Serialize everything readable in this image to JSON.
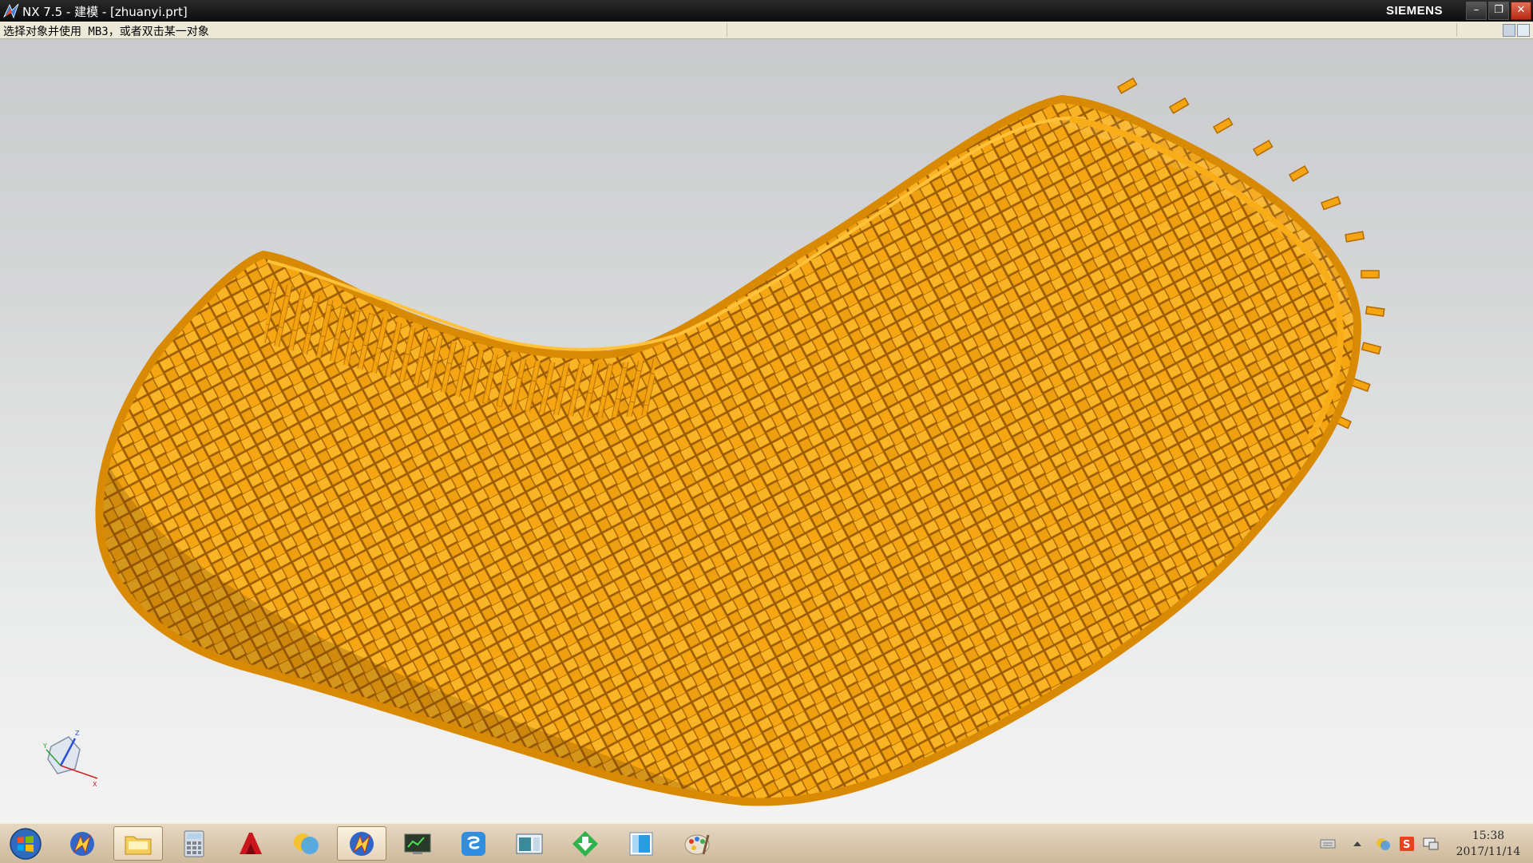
{
  "window": {
    "title": "NX 7.5 - 建模 - [zhuanyi.prt]",
    "brand": "SIEMENS",
    "minimize_icon": "minimize-icon",
    "restore_icon": "restore-icon",
    "close_icon": "close-icon"
  },
  "cue_line": {
    "prompt": "选择对象并使用 MB3，或者双击某一对象"
  },
  "viewport": {
    "model_color": "#f2a10f",
    "model_edge_color": "#b96f00",
    "background_top": "#c9cacb",
    "background_bottom": "#f3f3f3",
    "triad_icon": "csys-triad-icon"
  },
  "taskbar": {
    "start_icon": "windows-start-icon",
    "apps": [
      {
        "icon": "nx-icon"
      },
      {
        "icon": "folder-icon"
      },
      {
        "icon": "calculator-icon"
      },
      {
        "icon": "autocad-icon"
      },
      {
        "icon": "chat-icon"
      },
      {
        "icon": "nx-icon-active"
      },
      {
        "icon": "terminal-icon"
      },
      {
        "icon": "qq-icon"
      },
      {
        "icon": "window-app-icon"
      },
      {
        "icon": "download-icon"
      },
      {
        "icon": "blue-app-icon"
      },
      {
        "icon": "paint-icon"
      }
    ],
    "tray": [
      {
        "icon": "keyboard-icon"
      },
      {
        "icon": "show-hidden-icon"
      },
      {
        "icon": "network-icon"
      },
      {
        "icon": "sogou-input-icon"
      },
      {
        "icon": "monitor-icon"
      }
    ],
    "clock_time": "15:38",
    "clock_date": "2017/11/14"
  }
}
